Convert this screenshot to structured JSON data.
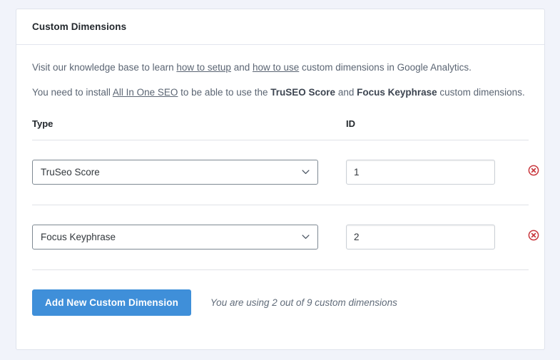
{
  "card": {
    "title": "Custom Dimensions"
  },
  "description": {
    "line1_part1": "Visit our knowledge base to learn ",
    "line1_link1": "how to setup",
    "line1_part2": " and ",
    "line1_link2": "how to use",
    "line1_part3": " custom dimensions in Google Analytics.",
    "line2_part1": "You need to install ",
    "line2_link1": "All In One SEO",
    "line2_part2": " to be able to use the ",
    "line2_bold1": "TruSEO Score",
    "line2_part3": " and ",
    "line2_bold2": "Focus Keyphrase",
    "line2_part4": " custom dimensions."
  },
  "table": {
    "headers": {
      "type": "Type",
      "id": "ID"
    },
    "rows": [
      {
        "type": "TruSeo Score",
        "id": "1",
        "delete_icon": "delete-circle-icon"
      },
      {
        "type": "Focus Keyphrase",
        "id": "2",
        "delete_icon": "delete-circle-icon"
      }
    ],
    "type_options": [
      "TruSeo Score",
      "Focus Keyphrase"
    ]
  },
  "footer": {
    "add_button_label": "Add New Custom Dimension",
    "usage_text": "You are using 2 out of 9 custom dimensions"
  },
  "colors": {
    "primary_button": "#3f8fd9",
    "delete_icon": "#c9373d",
    "page_background": "#f1f3fa",
    "card_background": "#ffffff"
  },
  "icons": {
    "chevron": "chevron-down-icon"
  }
}
